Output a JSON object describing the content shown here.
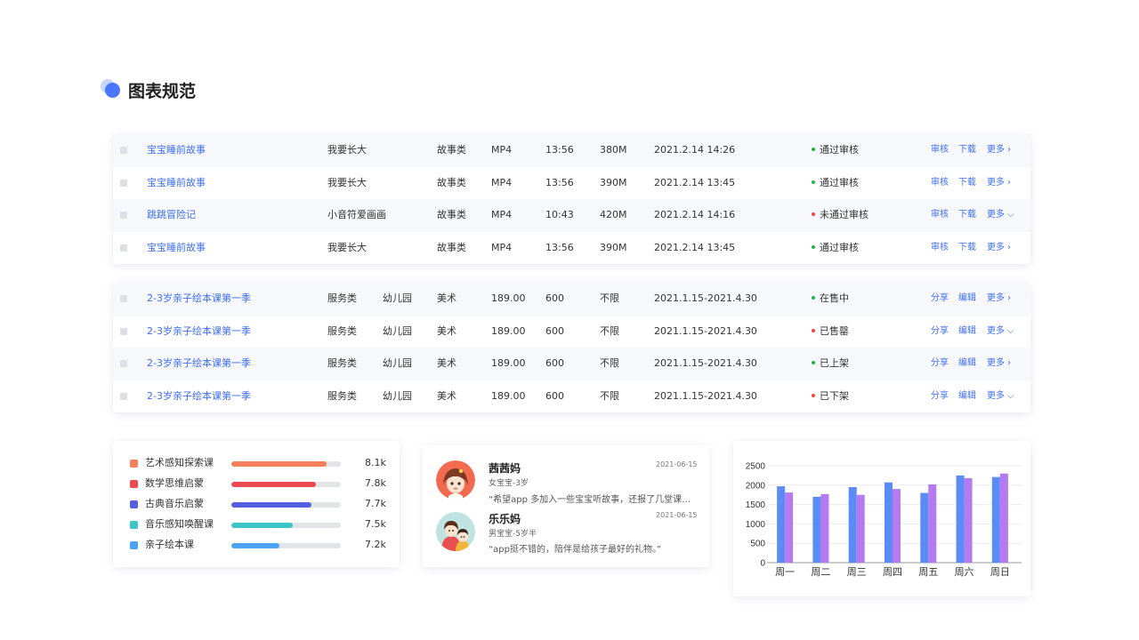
{
  "page": {
    "title": "图表规范"
  },
  "table1": {
    "rows": [
      {
        "name": "宝宝睡前故事",
        "author": "我要长大",
        "category": "故事类",
        "format": "MP4",
        "duration": "13:56",
        "size": "380M",
        "date": "2021.2.14 14:26",
        "status": "通过审核",
        "status_color": "#29b34a",
        "actions": [
          "审核",
          "下载",
          "更多"
        ],
        "more_icon": "chevron-right"
      },
      {
        "name": "宝宝睡前故事",
        "author": "我要长大",
        "category": "故事类",
        "format": "MP4",
        "duration": "13:56",
        "size": "390M",
        "date": "2021.2.14 13:45",
        "status": "通过审核",
        "status_color": "#29b34a",
        "actions": [
          "审核",
          "下载",
          "更多"
        ],
        "more_icon": "chevron-right"
      },
      {
        "name": "跳跳冒险记",
        "author": "小音符爱画画",
        "category": "故事类",
        "format": "MP4",
        "duration": "10:43",
        "size": "420M",
        "date": "2021.2.14 14:16",
        "status": "未通过审核",
        "status_color": "#f0483e",
        "actions": [
          "审核",
          "下载",
          "更多"
        ],
        "more_icon": "chevron-down"
      },
      {
        "name": "宝宝睡前故事",
        "author": "我要长大",
        "category": "故事类",
        "format": "MP4",
        "duration": "13:56",
        "size": "390M",
        "date": "2021.2.14 13:45",
        "status": "通过审核",
        "status_color": "#29b34a",
        "actions": [
          "审核",
          "下载",
          "更多"
        ],
        "more_icon": "chevron-right"
      }
    ]
  },
  "table2": {
    "rows": [
      {
        "name": "2-3岁亲子绘本课第一季",
        "type": "服务类",
        "audience": "幼儿园",
        "subject": "美术",
        "price": "189.00",
        "stock": "600",
        "limit": "不限",
        "period": "2021.1.15-2021.4.30",
        "status": "在售中",
        "status_color": "#29b34a",
        "actions": [
          "分享",
          "编辑",
          "更多"
        ],
        "more_icon": "chevron-right"
      },
      {
        "name": "2-3岁亲子绘本课第一季",
        "type": "服务类",
        "audience": "幼儿园",
        "subject": "美术",
        "price": "189.00",
        "stock": "600",
        "limit": "不限",
        "period": "2021.1.15-2021.4.30",
        "status": "已售罄",
        "status_color": "#f0483e",
        "actions": [
          "分享",
          "编辑",
          "更多"
        ],
        "more_icon": "chevron-down"
      },
      {
        "name": "2-3岁亲子绘本课第一季",
        "type": "服务类",
        "audience": "幼儿园",
        "subject": "美术",
        "price": "189.00",
        "stock": "600",
        "limit": "不限",
        "period": "2021.1.15-2021.4.30",
        "status": "已上架",
        "status_color": "#29b34a",
        "actions": [
          "分享",
          "编辑",
          "更多"
        ],
        "more_icon": "chevron-right"
      },
      {
        "name": "2-3岁亲子绘本课第一季",
        "type": "服务类",
        "audience": "幼儿园",
        "subject": "美术",
        "price": "189.00",
        "stock": "600",
        "limit": "不限",
        "period": "2021.1.15-2021.4.30",
        "status": "已下架",
        "status_color": "#f0483e",
        "actions": [
          "分享",
          "编辑",
          "更多"
        ],
        "more_icon": "chevron-down"
      }
    ]
  },
  "legend": {
    "items": [
      {
        "label": "艺术感知探索课",
        "value": "8.1k",
        "color": "#f87f5b",
        "fraction": 0.87
      },
      {
        "label": "数学思维启蒙",
        "value": "7.8k",
        "color": "#ec4b52",
        "fraction": 0.77
      },
      {
        "label": "古典音乐启蒙",
        "value": "7.7k",
        "color": "#5360e0",
        "fraction": 0.73
      },
      {
        "label": "音乐感知唤醒课",
        "value": "7.5k",
        "color": "#3cc6c7",
        "fraction": 0.56
      },
      {
        "label": "亲子绘本课",
        "value": "7.2k",
        "color": "#4aa3f5",
        "fraction": 0.44
      }
    ]
  },
  "reviews": [
    {
      "name": "茜茜妈",
      "meta": "女宝宝-3岁",
      "text": "“希望app 多加入一些宝宝听故事，还报了几堂课…",
      "date": "2021-06-15"
    },
    {
      "name": "乐乐妈",
      "meta": "男宝宝-5岁半",
      "text": "“app挺不错的，陪伴是给孩子最好的礼物。”",
      "date": "2021-06-15"
    }
  ],
  "chart_data": {
    "type": "bar",
    "categories": [
      "周一",
      "周二",
      "周三",
      "周四",
      "周五",
      "周六",
      "周日"
    ],
    "series": [
      {
        "values": [
          1970,
          1700,
          1950,
          2070,
          1800,
          2250,
          2210
        ],
        "color": "#5b8cf5"
      },
      {
        "values": [
          1810,
          1770,
          1750,
          1900,
          2020,
          2180,
          2300
        ],
        "color": "#b57af0"
      }
    ],
    "yticks": [
      "2500",
      "2000",
      "1500",
      "1000",
      "500",
      "0"
    ],
    "ylim": [
      0,
      2500
    ],
    "grid": true,
    "title": "",
    "xlabel": "",
    "ylabel": ""
  }
}
